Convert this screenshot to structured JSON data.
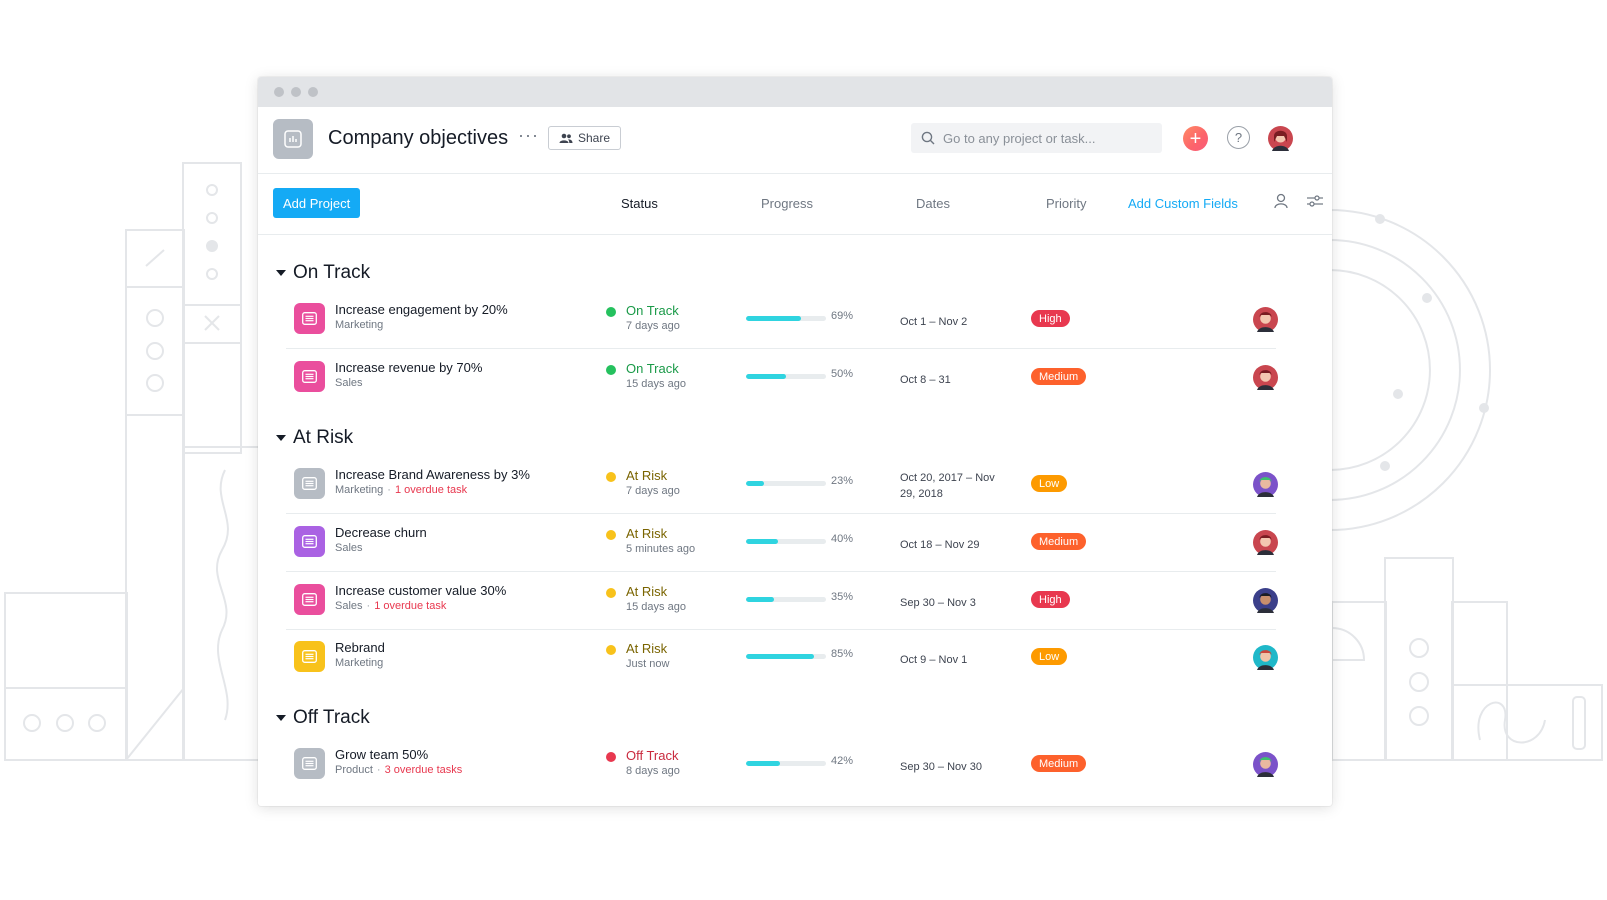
{
  "header": {
    "title": "Company objectives",
    "more": "···",
    "share_label": "Share",
    "search_placeholder": "Go to any project or task...",
    "add_glyph": "+",
    "help_glyph": "?"
  },
  "toolbar": {
    "add_project_label": "Add Project",
    "columns": {
      "status": "Status",
      "progress": "Progress",
      "dates": "Dates",
      "priority": "Priority",
      "add_custom_fields": "Add Custom Fields"
    }
  },
  "sections": [
    {
      "title": "On Track",
      "rows": [
        {
          "name": "Increase engagement by 20%",
          "team": "Marketing",
          "overdue": "",
          "status": "On Track",
          "status_time": "7 days ago",
          "progress": 69,
          "progress_label": "69%",
          "dates": "Oct 1 – Nov 2",
          "priority": "High",
          "icon_color": "#ea4e9d",
          "avatar": "red-hair"
        },
        {
          "name": "Increase revenue by 70%",
          "team": "Sales",
          "overdue": "",
          "status": "On Track",
          "status_time": "15 days ago",
          "progress": 50,
          "progress_label": "50%",
          "dates": "Oct 8 – 31",
          "priority": "Medium",
          "icon_color": "#ea4e9d",
          "avatar": "red-hair"
        }
      ]
    },
    {
      "title": "At Risk",
      "rows": [
        {
          "name": "Increase Brand Awareness by 3%",
          "team": "Marketing",
          "overdue": "1 overdue task",
          "status": "At Risk",
          "status_time": "7 days ago",
          "progress": 23,
          "progress_label": "23%",
          "dates": "Oct 20, 2017 – Nov 29, 2018",
          "priority": "Low",
          "icon_color": "#b6bcc4",
          "avatar": "green-hair"
        },
        {
          "name": "Decrease churn",
          "team": "Sales",
          "overdue": "",
          "status": "At Risk",
          "status_time": "5 minutes ago",
          "progress": 40,
          "progress_label": "40%",
          "dates": "Oct 18 – Nov 29",
          "priority": "Medium",
          "icon_color": "#aa62e3",
          "avatar": "red-hair"
        },
        {
          "name": "Increase customer value 30%",
          "team": "Sales",
          "overdue": "1 overdue task",
          "status": "At Risk",
          "status_time": "15 days ago",
          "progress": 35,
          "progress_label": "35%",
          "dates": "Sep 30 – Nov 3",
          "priority": "High",
          "icon_color": "#ea4e9d",
          "avatar": "dark-hair"
        },
        {
          "name": "Rebrand",
          "team": "Marketing",
          "overdue": "",
          "status": "At Risk",
          "status_time": "Just now",
          "progress": 85,
          "progress_label": "85%",
          "dates": "Oct 9 – Nov 1",
          "priority": "Low",
          "icon_color": "#f8c21b",
          "avatar": "teal-bg"
        }
      ]
    },
    {
      "title": "Off Track",
      "rows": [
        {
          "name": "Grow team 50%",
          "team": "Product",
          "overdue": "3 overdue tasks",
          "status": "Off Track",
          "status_time": "8 days ago",
          "progress": 42,
          "progress_label": "42%",
          "dates": "Sep 30 – Nov 30",
          "priority": "Medium",
          "icon_color": "#b6bcc4",
          "avatar": "green-hair"
        }
      ]
    }
  ],
  "colors": {
    "accent": "#14aaf5",
    "on_track": "#25c15e",
    "on_track_text": "#1a9a48",
    "at_risk": "#f8c21b",
    "at_risk_text": "#7a6400",
    "off_track": "#e8384f",
    "off_track_text": "#c92a3e",
    "priority_high": "#e8384f",
    "priority_medium": "#fd612c",
    "priority_low": "#fd9a00",
    "progress": "#2fd4e0"
  },
  "icons": {
    "project": "bar-chart-icon",
    "row": "list-doc-icon",
    "search": "search-icon",
    "share": "people-icon",
    "member": "person-icon",
    "filter": "sliders-icon"
  }
}
